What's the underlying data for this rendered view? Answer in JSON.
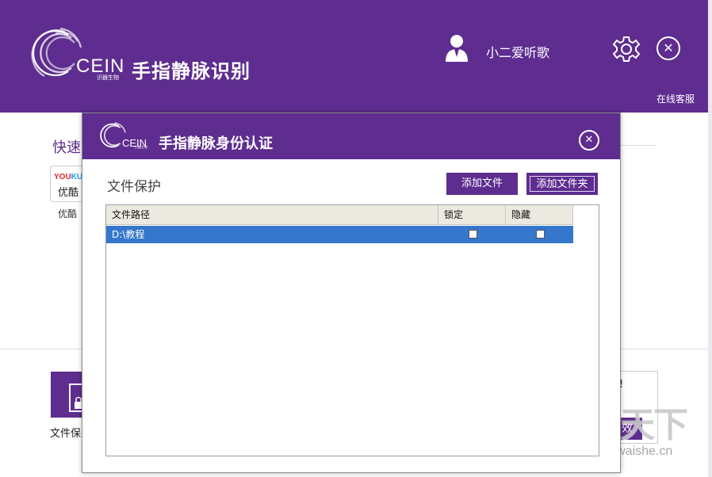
{
  "colors": {
    "brand_purple": "#5e2d8f",
    "row_selected": "#3477cc",
    "header_gray": "#ece9e0"
  },
  "main": {
    "logo_text": "CEIN",
    "logo_subtext": "识器生物",
    "title": "手指静脉识别",
    "user_icon": "user-icon",
    "user_name": "小二爱听歌",
    "settings_icon": "gear-icon",
    "close_icon": "close-icon",
    "online_service": "在线客服",
    "quick_label": "快速",
    "apps": [
      {
        "name": "优酷",
        "tile_text": "优酷",
        "logo": [
          "YOU",
          "KU"
        ]
      }
    ],
    "features": [
      {
        "label": "文件保"
      }
    ],
    "right_card": {
      "text": "!",
      "button": "效"
    }
  },
  "watermark": {
    "text": "外设天下",
    "url": "www.pcwaishe.cn"
  },
  "dialog": {
    "logo_text": "CEIN",
    "logo_subtext": "识器生物",
    "title": "手指静脉身份认证",
    "close_icon": "close-icon",
    "section_title": "文件保护",
    "buttons": {
      "add_file": "添加文件",
      "add_folder": "添加文件夹"
    },
    "table": {
      "columns": [
        "文件路径",
        "锁定",
        "隐藏"
      ],
      "rows": [
        {
          "path": "D:\\教程",
          "locked": false,
          "hidden": false
        }
      ]
    }
  }
}
